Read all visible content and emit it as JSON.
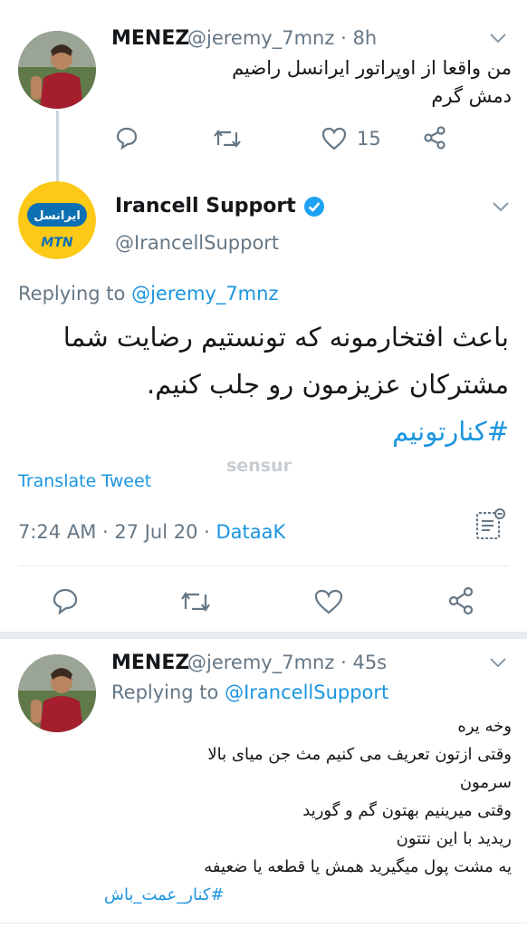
{
  "tweet1": {
    "display_name": "MENEZ",
    "handle": "@jeremy_7mnz",
    "sep": "·",
    "time": "8h",
    "text_lines": [
      "من واقعا از اوپراتور ایرانسل راضیم",
      "دمش گرم"
    ],
    "like_count": "15"
  },
  "main_tweet": {
    "display_name": "Irancell Support",
    "handle": "@IrancellSupport",
    "avatar_top_text": "ایرانسل",
    "avatar_bottom_text": "MTN",
    "replying_label": "Replying to",
    "replying_handle": "@jeremy_7mnz",
    "text_lines": [
      "باعث افتخارمونه که تونستیم رضایت شما",
      "مشترکان عزیزمون رو جلب کنیم."
    ],
    "hashtag": "#کنارتونیم",
    "translate_label": "Translate Tweet",
    "watermark": "sensur",
    "timestamp": "7:24 AM · 27 Jul 20 ·",
    "source": "DataaK"
  },
  "tweet3": {
    "display_name": "MENEZ",
    "handle": "@jeremy_7mnz",
    "sep": "·",
    "time": "45s",
    "replying_label": "Replying to",
    "replying_handle": "@IrancellSupport",
    "text_lines": [
      "وخه یره",
      "وقتی ازتون تعریف می کنیم مث جن میای بالا",
      "سرمون",
      "وقتی میرینیم بهتون گم و گورید",
      "ریدید با این نتتون",
      "یه مشت پول میگیرید همش یا قطعه یا ضعیفه"
    ],
    "hashtag": "#کنار_عمت_باش"
  },
  "colors": {
    "link": "#1b95e0",
    "muted": "#657786",
    "verified": "#1da1f2",
    "irancell_yellow": "#fcc917",
    "irancell_blue": "#0b6fb3"
  },
  "icons": [
    "reply-icon",
    "retweet-icon",
    "like-icon",
    "share-icon",
    "chevron-down-icon",
    "verified-badge-icon",
    "analytics-icon"
  ]
}
